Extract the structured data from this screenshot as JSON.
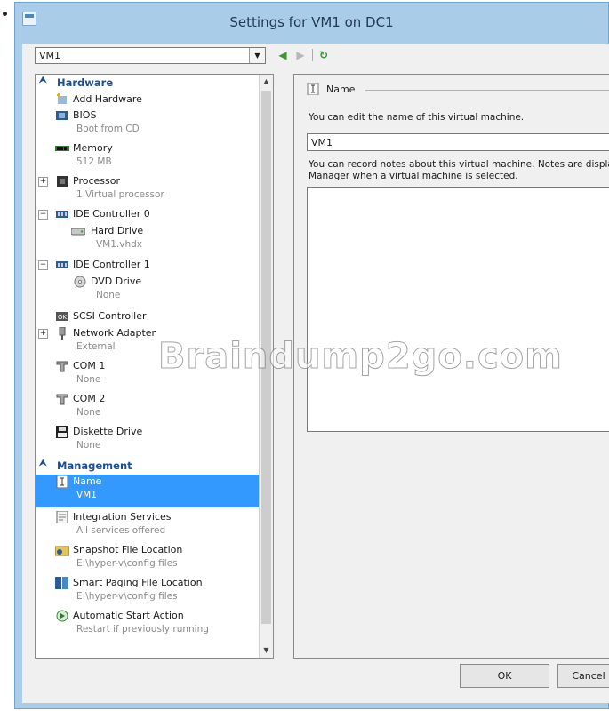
{
  "window": {
    "title": "Settings for VM1 on DC1"
  },
  "vm_selector": {
    "value": "VM1"
  },
  "tree": {
    "hardware_header": "Hardware",
    "management_header": "Management",
    "hardware_items": [
      {
        "name": "Add Hardware",
        "sub": "",
        "icon": "add-hardware-icon"
      },
      {
        "name": "BIOS",
        "sub": "Boot from CD",
        "icon": "bios-icon"
      },
      {
        "name": "Memory",
        "sub": "512 MB",
        "icon": "memory-icon"
      },
      {
        "name": "Processor",
        "sub": "1 Virtual processor",
        "icon": "processor-icon"
      },
      {
        "name": "IDE Controller 0",
        "sub": "",
        "icon": "ide-controller-icon"
      },
      {
        "name": "Hard Drive",
        "sub": "VM1.vhdx",
        "icon": "hard-drive-icon"
      },
      {
        "name": "IDE Controller 1",
        "sub": "",
        "icon": "ide-controller-icon"
      },
      {
        "name": "DVD Drive",
        "sub": "None",
        "icon": "dvd-drive-icon"
      },
      {
        "name": "SCSI Controller",
        "sub": "",
        "icon": "scsi-controller-icon"
      },
      {
        "name": "Network Adapter",
        "sub": "External",
        "icon": "network-adapter-icon"
      },
      {
        "name": "COM 1",
        "sub": "None",
        "icon": "com-port-icon"
      },
      {
        "name": "COM 2",
        "sub": "None",
        "icon": "com-port-icon"
      },
      {
        "name": "Diskette Drive",
        "sub": "None",
        "icon": "diskette-drive-icon"
      }
    ],
    "management_items": [
      {
        "name": "Name",
        "sub": "VM1",
        "icon": "name-icon"
      },
      {
        "name": "Integration Services",
        "sub": "All services offered",
        "icon": "integration-services-icon"
      },
      {
        "name": "Snapshot File Location",
        "sub": "E:\\hyper-v\\config files",
        "icon": "snapshot-location-icon"
      },
      {
        "name": "Smart Paging File Location",
        "sub": "E:\\hyper-v\\config files",
        "icon": "smart-paging-icon"
      },
      {
        "name": "Automatic Start Action",
        "sub": "Restart if previously running",
        "icon": "automatic-start-icon"
      }
    ]
  },
  "details": {
    "group_title": "Name",
    "edit_hint": "You can edit the name of this virtual machine.",
    "name_value": "VM1",
    "notes_hint_line1": "You can record notes about this virtual machine. Notes are displaye",
    "notes_hint_line2": "Manager when a virtual machine is selected.",
    "notes_value": ""
  },
  "buttons": {
    "ok": "OK",
    "cancel": "Cancel"
  },
  "watermark": "Braindump2go.com",
  "colors": {
    "selection": "#3399ff",
    "section_header": "#1b4f93",
    "frame": "#a9cce8"
  }
}
